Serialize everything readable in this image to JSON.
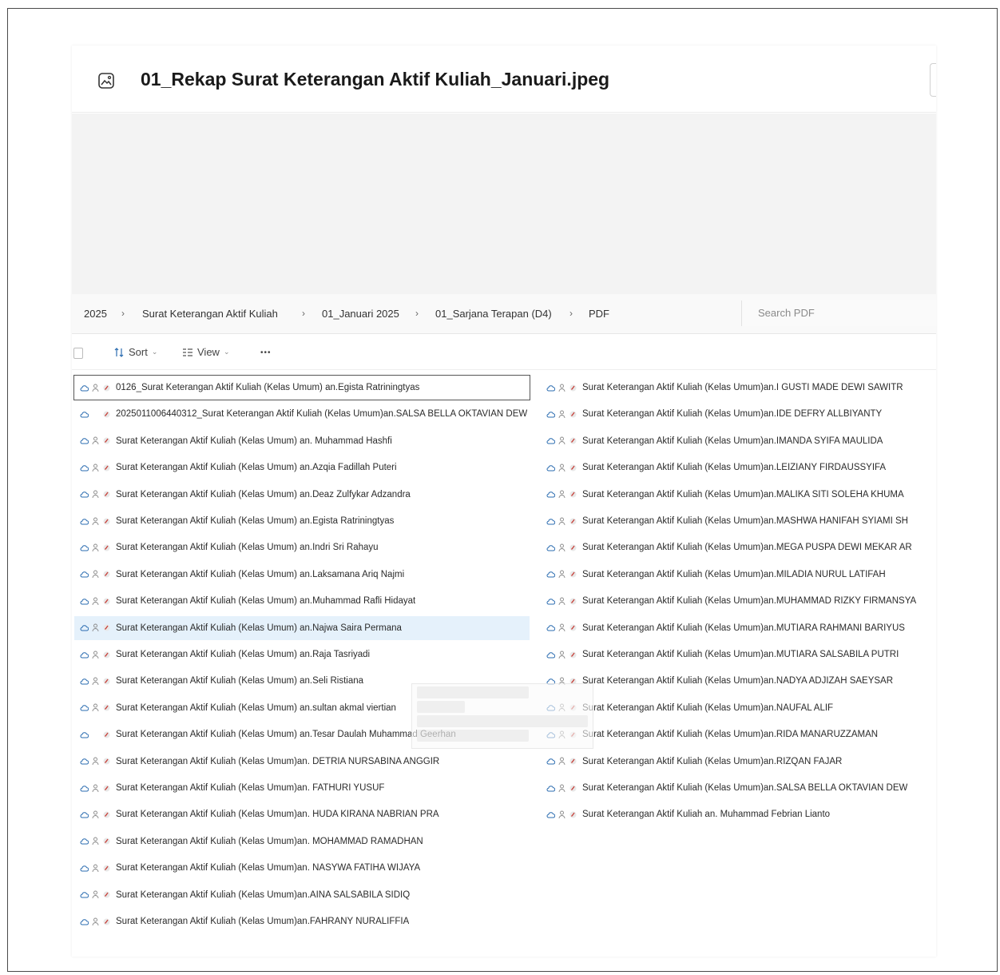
{
  "window": {
    "title": "01_Rekap Surat Keterangan Aktif Kuliah_Januari.jpeg"
  },
  "breadcrumb": [
    "2025",
    "Surat Keterangan Aktif Kuliah",
    "01_Januari 2025",
    "01_Sarjana Terapan (D4)",
    "PDF"
  ],
  "search": {
    "placeholder": "Search PDF"
  },
  "toolbar": {
    "sort_label": "Sort",
    "view_label": "View",
    "more_label": "•••"
  },
  "files_left": [
    "0126_Surat Keterangan Aktif Kuliah (Kelas Umum) an.Egista Ratriningtyas",
    "20250110064403​12_Surat Keterangan Aktif Kuliah (Kelas Umum)an.SALSA BELLA OKTAVIAN DEW",
    "Surat Keterangan Aktif Kuliah (Kelas Umum) an. Muhammad Hashfi",
    "Surat Keterangan Aktif Kuliah (Kelas Umum) an.Azqia Fadillah Puteri",
    "Surat Keterangan Aktif Kuliah (Kelas Umum) an.Deaz Zulfykar Adzandra",
    "Surat Keterangan Aktif Kuliah (Kelas Umum) an.Egista Ratriningtyas",
    "Surat Keterangan Aktif Kuliah (Kelas Umum) an.Indri Sri Rahayu",
    "Surat Keterangan Aktif Kuliah (Kelas Umum) an.Laksamana Ariq Najmi",
    "Surat Keterangan Aktif Kuliah (Kelas Umum) an.Muhammad Rafli Hidayat",
    "Surat Keterangan Aktif Kuliah (Kelas Umum) an.Najwa Saira Permana",
    "Surat Keterangan Aktif Kuliah (Kelas Umum) an.Raja Tasriyadi",
    "Surat Keterangan Aktif Kuliah (Kelas Umum) an.Seli Ristiana",
    "Surat Keterangan Aktif Kuliah (Kelas Umum) an.sultan akmal viertian",
    "Surat Keterangan Aktif Kuliah (Kelas Umum) an.Tesar Daulah Muhammad Geerhan",
    "Surat Keterangan Aktif Kuliah (Kelas Umum)an. DETRIA NURSABINA ANGGIR",
    "Surat Keterangan Aktif Kuliah (Kelas Umum)an. FATHURI YUSUF",
    "Surat Keterangan Aktif Kuliah (Kelas Umum)an. HUDA KIRANA NABRIAN PRA",
    "Surat Keterangan Aktif Kuliah (Kelas Umum)an. MOHAMMAD RAMADHAN",
    "Surat Keterangan Aktif Kuliah (Kelas Umum)an. NASYWA FATIHA WIJAYA",
    "Surat Keterangan Aktif Kuliah (Kelas Umum)an.AINA SALSABILA SIDIQ",
    "Surat Keterangan Aktif Kuliah (Kelas Umum)an.FAHRANY NURALIFFIA"
  ],
  "files_right": [
    "Surat Keterangan Aktif Kuliah (Kelas Umum)an.I GUSTI MADE DEWI SAWITR",
    "Surat Keterangan Aktif Kuliah (Kelas Umum)an.IDE DEFRY ALLBIYANTY",
    "Surat Keterangan Aktif Kuliah (Kelas Umum)an.IMANDA SYIFA MAULIDA",
    "Surat Keterangan Aktif Kuliah (Kelas Umum)an.LEIZIANY FIRDAUSSYIFA",
    "Surat Keterangan Aktif Kuliah (Kelas Umum)an.MALIKA SITI SOLEHA KHUMA",
    "Surat Keterangan Aktif Kuliah (Kelas Umum)an.MASHWA HANIFAH SYIAMI SH",
    "Surat Keterangan Aktif Kuliah (Kelas Umum)an.MEGA PUSPA DEWI MEKAR AR",
    "Surat Keterangan Aktif Kuliah (Kelas Umum)an.MILADIA NURUL LATIFAH",
    "Surat Keterangan Aktif Kuliah (Kelas Umum)an.MUHAMMAD RIZKY FIRMANSYA",
    "Surat Keterangan Aktif Kuliah (Kelas Umum)an.MUTIARA RAHMANI BARIYUS",
    "Surat Keterangan Aktif Kuliah (Kelas Umum)an.MUTIARA SALSABILA PUTRI",
    "Surat Keterangan Aktif Kuliah (Kelas Umum)an.NADYA ADJIZAH SAEYSAR",
    "Surat Keterangan Aktif Kuliah (Kelas Umum)an.NAUFAL ALIF",
    "Surat Keterangan Aktif Kuliah (Kelas Umum)an.RIDA MANARUZZAMAN",
    "Surat Keterangan Aktif Kuliah (Kelas Umum)an.RIZQAN FAJAR",
    "Surat Keterangan Aktif Kuliah (Kelas Umum)an.SALSA BELLA OKTAVIAN DEW",
    "Surat Keterangan Aktif Kuliah an. Muhammad Febrian Lianto"
  ],
  "selected_index": 0,
  "hovered_index": 9,
  "colors": {
    "hover": "#e5f1fb",
    "pdf_red": "#c8413a",
    "accent": "#0f6cbd"
  }
}
